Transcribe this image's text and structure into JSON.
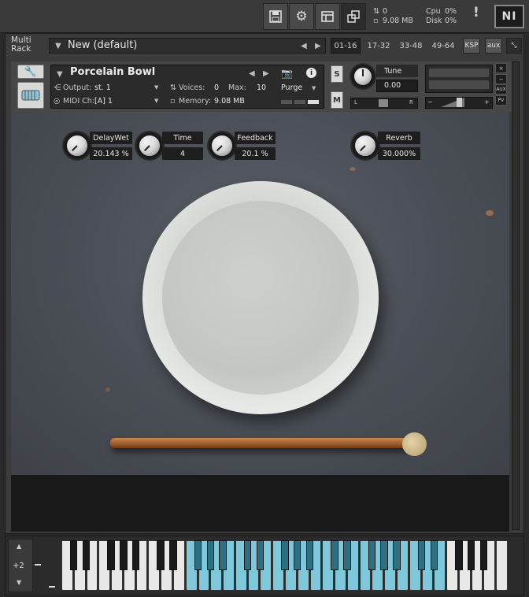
{
  "toolbar": {
    "save_icon": "save-icon",
    "settings_icon": "gear-icon",
    "view_icon": "layout-icon",
    "resize_icon": "window-resize-icon",
    "midi_count": "0",
    "memory": "9.08 MB",
    "cpu_label": "Cpu",
    "cpu_value": "0%",
    "disk_label": "Disk",
    "disk_value": "0%",
    "warning": "!",
    "logo": "NI"
  },
  "rack": {
    "label_line1": "Multi",
    "label_line2": "Rack",
    "preset_name": "New (default)",
    "pages": [
      "01-16",
      "17-32",
      "33-48",
      "49-64"
    ],
    "ksp": "KSP",
    "aux": "aux"
  },
  "instrument": {
    "name": "Porcelain Bowl",
    "output_label": "Output:",
    "output_value": "st. 1",
    "voices_label": "Voices:",
    "voices_value": "0",
    "max_label": "Max:",
    "max_value": "10",
    "purge_label": "Purge",
    "midi_label": "MIDI Ch:",
    "midi_value": "[A]  1",
    "memory_label": "Memory:",
    "memory_value": "9.08 MB",
    "solo": "S",
    "mute": "M",
    "tune_label": "Tune",
    "tune_value": "0.00",
    "pan_left": "L",
    "pan_right": "R",
    "vol_minus": "−",
    "vol_plus": "+",
    "aux_label": "AUX",
    "pv_label": "PV",
    "close": "×",
    "minimize": "−"
  },
  "controls": [
    {
      "label": "DelayWet",
      "value": "20.143 %"
    },
    {
      "label": "Time",
      "value": "4"
    },
    {
      "label": "Feedback",
      "value": "20.1  %"
    },
    {
      "label": "Reverb",
      "value": "30.000%"
    }
  ],
  "keyboard": {
    "octave_shift": "+2",
    "white_keys_total": 36,
    "highlight_start": 10,
    "highlight_end": 31,
    "highlight_color": "#7fc8dc"
  },
  "colors": {
    "accent": "#7fc8dc",
    "panel": "#3b3b3b",
    "dark": "#1e1e1e"
  }
}
